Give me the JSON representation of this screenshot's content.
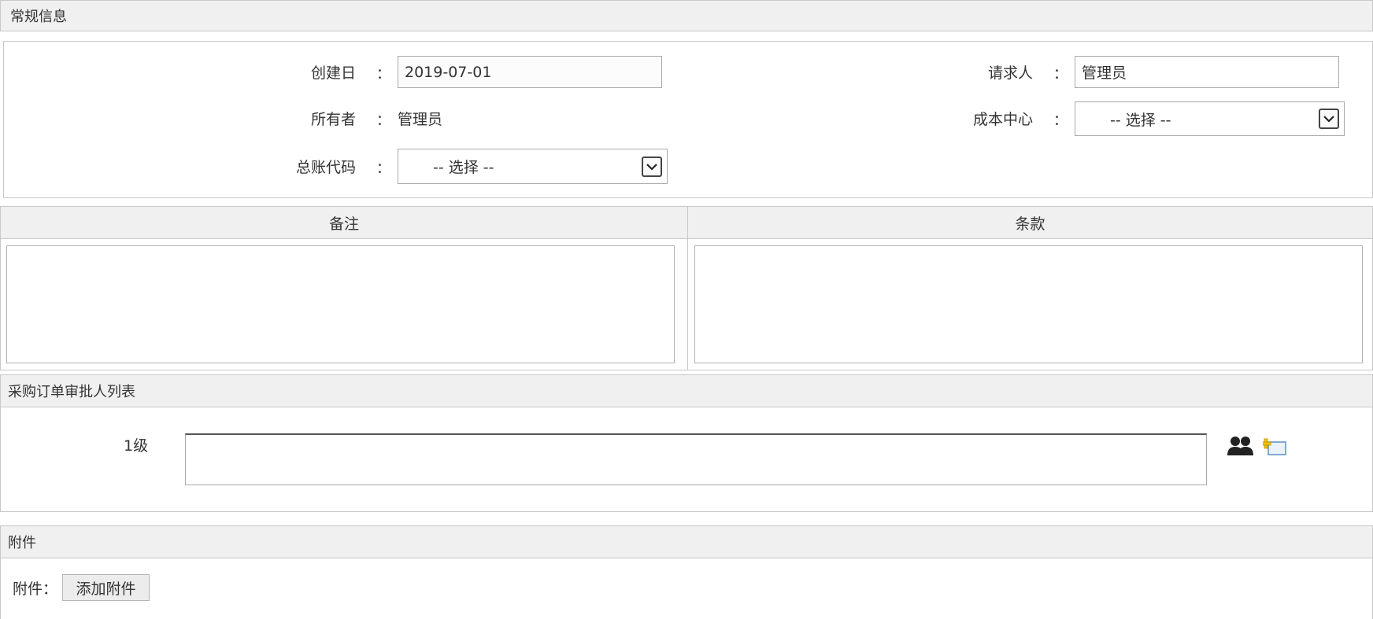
{
  "general": {
    "title": "常规信息",
    "created_label": "创建日",
    "created_value": "2019-07-01",
    "owner_label": "所有者",
    "owner_value": "管理员",
    "gl_label": "总账代码",
    "gl_value": "-- 选择 --",
    "requester_label": "请求人",
    "requester_value": "管理员",
    "cost_center_label": "成本中心",
    "cost_center_value": "-- 选择 --",
    "colon": "："
  },
  "notes": {
    "remarks_header": "备注",
    "terms_header": "条款"
  },
  "approvers": {
    "title": "采购订单审批人列表",
    "level_label": "1级",
    "users_icon": "users-icon",
    "add_icon": "add-icon"
  },
  "attachments": {
    "title": "附件",
    "label": "附件：",
    "add_button": "添加附件"
  },
  "colors": {
    "header_bg": "#f0f0f0",
    "border": "#c8c8c8",
    "add_icon_accent": "#f2c400"
  }
}
